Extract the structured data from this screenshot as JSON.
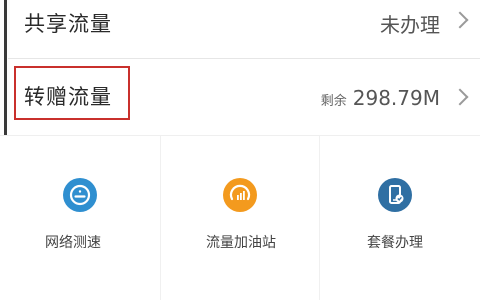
{
  "rows": [
    {
      "label": "共享流量",
      "value": "未办理"
    },
    {
      "label": "转赠流量",
      "remain_label": "剩余",
      "value": "298.79M"
    }
  ],
  "services": [
    {
      "label": "网络测速",
      "icon": "speedometer-icon",
      "color": "#2f8fd0"
    },
    {
      "label": "流量加油站",
      "icon": "gauge-icon",
      "color": "#f39a1e"
    },
    {
      "label": "套餐办理",
      "icon": "phone-plan-icon",
      "color": "#2f6fa3"
    }
  ],
  "colors": {
    "highlight": "#c9302c"
  }
}
